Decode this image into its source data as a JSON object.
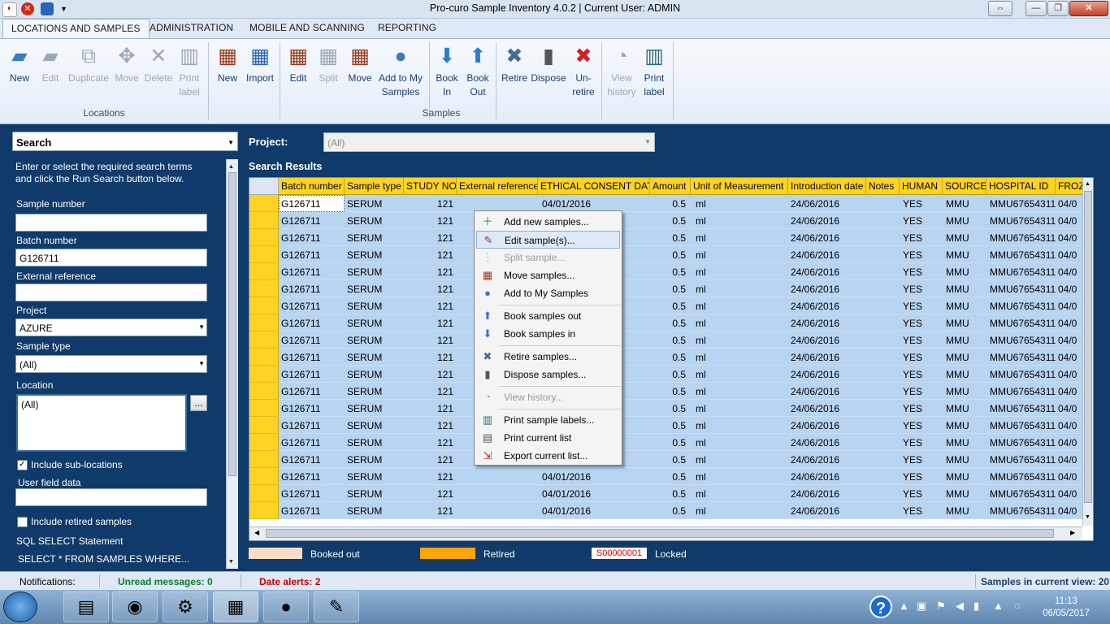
{
  "window": {
    "title": "Pro-curo Sample Inventory 4.0.2  | Current User: ADMIN"
  },
  "menu_tabs": [
    "LOCATIONS AND SAMPLES",
    "ADMINISTRATION",
    "MOBILE AND SCANNING",
    "REPORTING"
  ],
  "ribbon": {
    "locations_group": "Locations",
    "samples_group": "Samples",
    "locations_buttons": [
      {
        "label": "New",
        "icon": "location-new-icon",
        "enabled": true
      },
      {
        "label": "Edit",
        "icon": "location-edit-icon",
        "enabled": false
      },
      {
        "label": "Duplicate",
        "icon": "duplicate-icon",
        "enabled": false
      },
      {
        "label": "Move",
        "icon": "move-icon",
        "enabled": false
      },
      {
        "label": "Delete",
        "icon": "delete-icon",
        "enabled": false
      },
      {
        "label": "Print label",
        "icon": "barcode-icon",
        "enabled": false
      }
    ],
    "samples_buttons": [
      {
        "label": "New",
        "icon": "sample-new-icon",
        "enabled": true
      },
      {
        "label": "Import",
        "icon": "import-icon",
        "enabled": true
      },
      {
        "label": "Edit",
        "icon": "sample-edit-icon",
        "enabled": true
      },
      {
        "label": "Split",
        "icon": "split-icon",
        "enabled": false
      },
      {
        "label": "Move",
        "icon": "sample-move-icon",
        "enabled": true
      },
      {
        "label": "Add to My Samples",
        "icon": "add-to-my-samples-icon",
        "enabled": true
      },
      {
        "label": "Book In",
        "icon": "book-in-icon",
        "enabled": true
      },
      {
        "label": "Book Out",
        "icon": "book-out-icon",
        "enabled": true
      },
      {
        "label": "Retire",
        "icon": "retire-icon",
        "enabled": true
      },
      {
        "label": "Dispose",
        "icon": "dispose-icon",
        "enabled": true
      },
      {
        "label": "Un-retire",
        "icon": "unretire-icon",
        "enabled": true
      },
      {
        "label": "View history",
        "icon": "history-icon",
        "enabled": false
      },
      {
        "label": "Print label",
        "icon": "print-label-icon",
        "enabled": true
      }
    ]
  },
  "search_panel": {
    "header": "Search",
    "intro": "Enter or select the required search terms and click the Run Search button below.",
    "sample_number_label": "Sample number",
    "sample_number_value": "",
    "batch_number_label": "Batch number",
    "batch_number_value": "G126711",
    "external_reference_label": "External reference",
    "external_reference_value": "",
    "project_label": "Project",
    "project_value": "AZURE",
    "sample_type_label": "Sample type",
    "sample_type_value": "(All)",
    "location_label": "Location",
    "location_value": "(All)",
    "location_browse": "...",
    "include_sublocations_label": "Include sub-locations",
    "include_sublocations_checked": true,
    "user_field_label": "User field data",
    "user_field_value": "",
    "include_retired_label": "Include retired samples",
    "include_retired_checked": false,
    "sql_label": "SQL SELECT Statement",
    "sql_value": "SELECT * FROM SAMPLES WHERE..."
  },
  "project_bar": {
    "label": "Project:",
    "value": "(All)"
  },
  "results": {
    "title": "Search Results",
    "columns": [
      "Batch number",
      "Sample type",
      "STUDY NO",
      "External reference",
      "ETHICAL CONSENT DATE",
      "Amount",
      "Unit of Measurement",
      "Introduction date",
      "Notes",
      "HUMAN",
      "SOURCE",
      "HOSPITAL ID",
      "FROZ"
    ],
    "rows": [
      [
        "G126711",
        "SERUM",
        "121",
        "",
        "04/01/2016",
        "0.5",
        "ml",
        "24/06/2016",
        "",
        "YES",
        "MMU",
        "MMU67654311",
        "04/0"
      ],
      [
        "G126711",
        "SERUM",
        "121",
        "",
        "",
        "0.5",
        "ml",
        "24/06/2016",
        "",
        "YES",
        "MMU",
        "MMU67654311",
        "04/0"
      ],
      [
        "G126711",
        "SERUM",
        "121",
        "",
        "",
        "0.5",
        "ml",
        "24/06/2016",
        "",
        "YES",
        "MMU",
        "MMU67654311",
        "04/0"
      ],
      [
        "G126711",
        "SERUM",
        "121",
        "",
        "",
        "0.5",
        "ml",
        "24/06/2016",
        "",
        "YES",
        "MMU",
        "MMU67654311",
        "04/0"
      ],
      [
        "G126711",
        "SERUM",
        "121",
        "",
        "",
        "0.5",
        "ml",
        "24/06/2016",
        "",
        "YES",
        "MMU",
        "MMU67654311",
        "04/0"
      ],
      [
        "G126711",
        "SERUM",
        "121",
        "",
        "",
        "0.5",
        "ml",
        "24/06/2016",
        "",
        "YES",
        "MMU",
        "MMU67654311",
        "04/0"
      ],
      [
        "G126711",
        "SERUM",
        "121",
        "",
        "",
        "0.5",
        "ml",
        "24/06/2016",
        "",
        "YES",
        "MMU",
        "MMU67654311",
        "04/0"
      ],
      [
        "G126711",
        "SERUM",
        "121",
        "",
        "",
        "0.5",
        "ml",
        "24/06/2016",
        "",
        "YES",
        "MMU",
        "MMU67654311",
        "04/0"
      ],
      [
        "G126711",
        "SERUM",
        "121",
        "",
        "",
        "0.5",
        "ml",
        "24/06/2016",
        "",
        "YES",
        "MMU",
        "MMU67654311",
        "04/0"
      ],
      [
        "G126711",
        "SERUM",
        "121",
        "",
        "",
        "0.5",
        "ml",
        "24/06/2016",
        "",
        "YES",
        "MMU",
        "MMU67654311",
        "04/0"
      ],
      [
        "G126711",
        "SERUM",
        "121",
        "",
        "",
        "0.5",
        "ml",
        "24/06/2016",
        "",
        "YES",
        "MMU",
        "MMU67654311",
        "04/0"
      ],
      [
        "G126711",
        "SERUM",
        "121",
        "",
        "",
        "0.5",
        "ml",
        "24/06/2016",
        "",
        "YES",
        "MMU",
        "MMU67654311",
        "04/0"
      ],
      [
        "G126711",
        "SERUM",
        "121",
        "",
        "",
        "0.5",
        "ml",
        "24/06/2016",
        "",
        "YES",
        "MMU",
        "MMU67654311",
        "04/0"
      ],
      [
        "G126711",
        "SERUM",
        "121",
        "",
        "",
        "0.5",
        "ml",
        "24/06/2016",
        "",
        "YES",
        "MMU",
        "MMU67654311",
        "04/0"
      ],
      [
        "G126711",
        "SERUM",
        "121",
        "",
        "",
        "0.5",
        "ml",
        "24/06/2016",
        "",
        "YES",
        "MMU",
        "MMU67654311",
        "04/0"
      ],
      [
        "G126711",
        "SERUM",
        "121",
        "",
        "",
        "0.5",
        "ml",
        "24/06/2016",
        "",
        "YES",
        "MMU",
        "MMU67654311",
        "04/0"
      ],
      [
        "G126711",
        "SERUM",
        "121",
        "",
        "04/01/2016",
        "0.5",
        "ml",
        "24/06/2016",
        "",
        "YES",
        "MMU",
        "MMU67654311",
        "04/0"
      ],
      [
        "G126711",
        "SERUM",
        "121",
        "",
        "04/01/2016",
        "0.5",
        "ml",
        "24/06/2016",
        "",
        "YES",
        "MMU",
        "MMU67654311",
        "04/0"
      ],
      [
        "G126711",
        "SERUM",
        "121",
        "",
        "04/01/2016",
        "0.5",
        "ml",
        "24/06/2016",
        "",
        "YES",
        "MMU",
        "MMU67654311",
        "04/0"
      ]
    ]
  },
  "context_menu": [
    {
      "label": "Add new samples...",
      "icon": "add-sample-icon",
      "enabled": true,
      "highlighted": false
    },
    {
      "label": "Edit sample(s)...",
      "icon": "edit-sample-icon",
      "enabled": true,
      "highlighted": true
    },
    {
      "label": "Split sample...",
      "icon": "split-sample-icon",
      "enabled": false,
      "highlighted": false
    },
    {
      "label": "Move samples...",
      "icon": "move-samples-icon",
      "enabled": true,
      "highlighted": false
    },
    {
      "label": "Add to My Samples",
      "icon": "my-samples-icon",
      "enabled": true,
      "highlighted": false
    },
    {
      "label": "Book samples out",
      "icon": "arrow-up-icon",
      "enabled": true,
      "highlighted": false
    },
    {
      "label": "Book samples in",
      "icon": "arrow-down-icon",
      "enabled": true,
      "highlighted": false
    },
    {
      "label": "Retire samples...",
      "icon": "retire-x-icon",
      "enabled": true,
      "highlighted": false
    },
    {
      "label": "Dispose samples...",
      "icon": "bin-icon",
      "enabled": true,
      "highlighted": false
    },
    {
      "label": "View history...",
      "icon": "history-icon",
      "enabled": false,
      "highlighted": false
    },
    {
      "label": "Print sample labels...",
      "icon": "label-icon",
      "enabled": true,
      "highlighted": false
    },
    {
      "label": "Print current list",
      "icon": "printer-icon",
      "enabled": true,
      "highlighted": false
    },
    {
      "label": "Export current list...",
      "icon": "export-icon",
      "enabled": true,
      "highlighted": false
    }
  ],
  "legend": {
    "booked_out": "Booked out",
    "retired": "Retired",
    "locked_sample": "S00000001",
    "locked": "Locked",
    "colors": {
      "booked_out": "#fcdcc4",
      "retired": "#ffa500",
      "locked_text": "#e00000"
    }
  },
  "status": {
    "notifications": "Notifications:",
    "unread": "Unread messages: 0",
    "date_alerts": "Date alerts: 2",
    "samples_count": "Samples in current view: 20"
  },
  "taskbar": {
    "time": "11:13",
    "date": "06/05/2017"
  },
  "colors": {
    "accent_yellow": "#ffd324",
    "row_blue": "#b7d4f0",
    "panel_bg": "#0f3a6a"
  }
}
